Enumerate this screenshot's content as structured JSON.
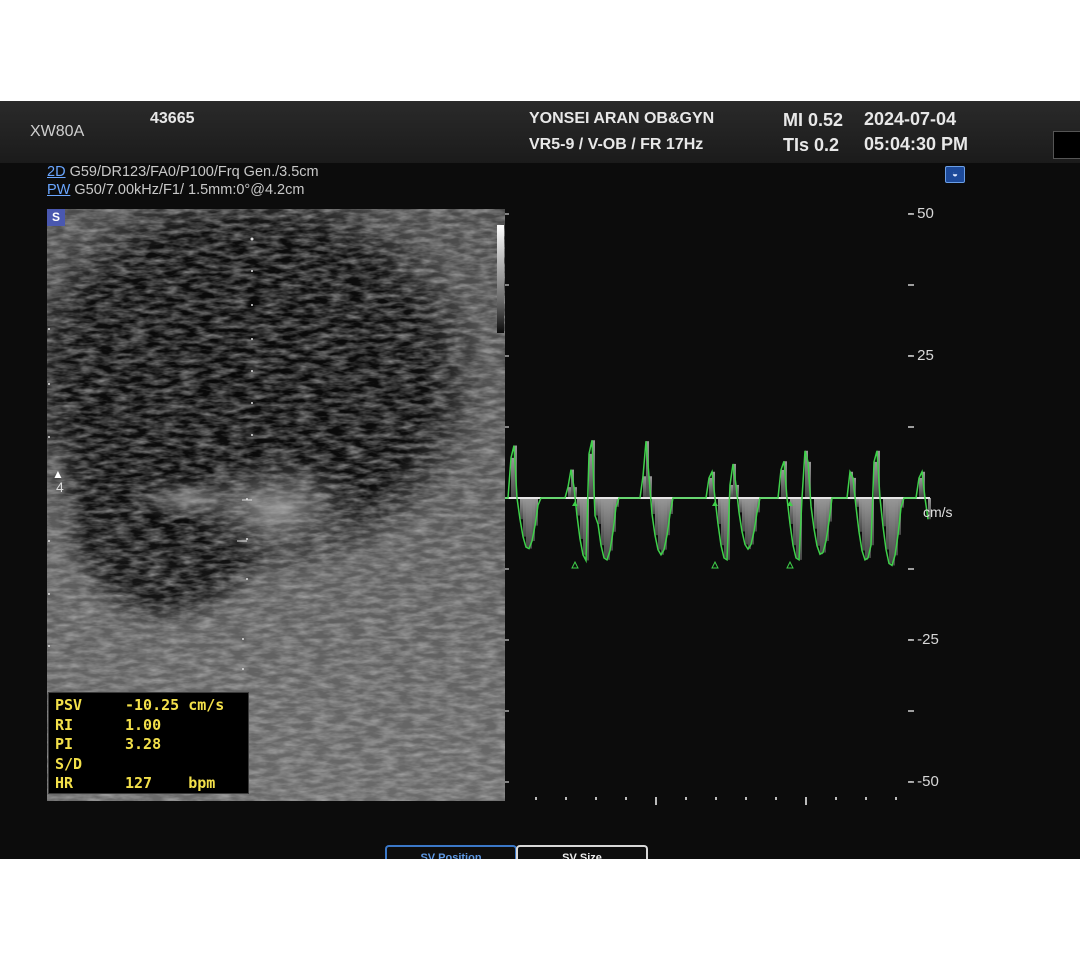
{
  "header": {
    "model": "XW80A",
    "patient_id": "43665",
    "hospital": "YONSEI ARAN OB&GYN",
    "probe_preset": "VR5-9 / V-OB / FR 17Hz",
    "mi": "MI  0.52",
    "tis": "TIs 0.2",
    "date": "2024-07-04",
    "time": "05:04:30 PM"
  },
  "params": {
    "mode_2d": "2D",
    "settings_2d": " G59/DR123/FA0/P100/Frq Gen./3.5cm",
    "mode_pw": "PW",
    "settings_pw": " G50/7.00kHz/F1/ 1.5mm:0°@4.2cm"
  },
  "bmode": {
    "s_badge": "S",
    "depth_marker": "4"
  },
  "measurements": [
    {
      "label": "PSV",
      "value": "-10.25 cm/s"
    },
    {
      "label": "RI",
      "value": "1.00"
    },
    {
      "label": "PI",
      "value": "3.28"
    },
    {
      "label": "S/D",
      "value": ""
    },
    {
      "label": "HR",
      "value": "127    bpm"
    }
  ],
  "doppler": {
    "unit": "cm/s",
    "ticks": [
      {
        "value": 50,
        "label": "- 50"
      },
      {
        "value": 25,
        "label": "- 25"
      },
      {
        "value": -25,
        "label": "- -25"
      },
      {
        "value": -50,
        "label": "- -50"
      }
    ],
    "range": [
      -50,
      50
    ],
    "baseline": 0,
    "trace_color": "#3fd14a",
    "peak_velocity": -10.25,
    "heart_rate_bpm": 127
  },
  "buttons": {
    "sv_position": "SV Position",
    "sv_size": "SV Size"
  }
}
